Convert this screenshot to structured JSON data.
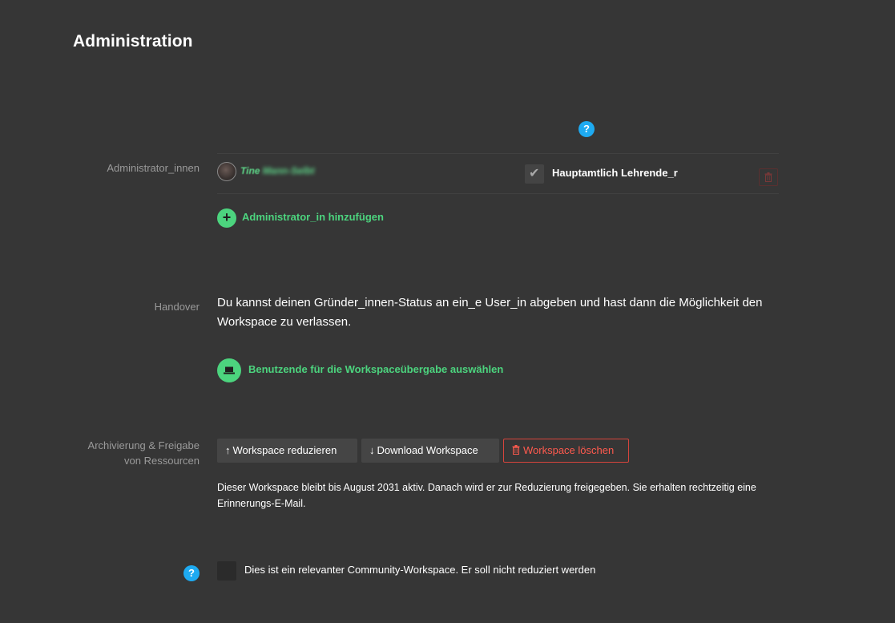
{
  "page": {
    "title": "Administration"
  },
  "administrators": {
    "label": "Administrator_innen",
    "help_icon": "question-mark-icon",
    "rows": [
      {
        "name_visible": "Tine",
        "name_blurred": "Mann-Selbt",
        "role_checked": true,
        "role_label": "Hauptamtlich Lehrende_r",
        "delete_icon": "trash-icon"
      }
    ],
    "add_label": "Administrator_in hinzufügen",
    "add_icon": "plus-icon"
  },
  "handover": {
    "label": "Handover",
    "text": "Du kannst deinen Gründer_innen-Status an ein_e User_in abgeben und hast dann die Möglichkeit den Workspace zu verlassen.",
    "select_label": "Benutzende für die Workspaceübergabe auswählen",
    "select_icon": "laptop-icon"
  },
  "archive": {
    "label_line1": "Archivierung & Freigabe",
    "label_line2": "von Ressourcen",
    "reduce_label": "Workspace reduzieren",
    "download_label": "Download Workspace",
    "delete_label": "Workspace löschen",
    "info_text": "Dieser Workspace bleibt bis August 2031 aktiv. Danach wird er zur Reduzierung freigegeben. Sie erhalten rechtzeitig eine Erinnerungs-E-Mail."
  },
  "community": {
    "checked": false,
    "label": "Dies ist ein relevanter Community-Workspace. Er soll nicht reduziert werden"
  },
  "colors": {
    "background": "#363636",
    "accent_green": "#4cd47e",
    "help_blue": "#1eaaf1",
    "danger_red": "#ff5a4e"
  }
}
